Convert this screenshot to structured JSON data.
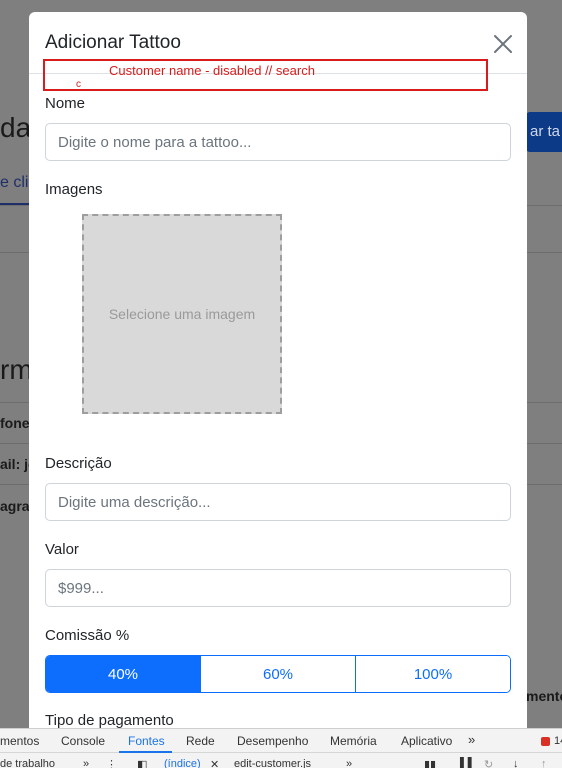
{
  "background": {
    "title_fragment": "da",
    "tab_fragment": "e cli",
    "form_title_fragment": "rm",
    "row1_fragment": "fone",
    "row2_fragment": "ail: jo",
    "row3_fragment": "agra",
    "button_fragment": "ar ta",
    "bottom_right_fragment": "mento"
  },
  "modal": {
    "title": "Adicionar Tattoo",
    "annotation": "Customer name - disabled // search",
    "annotation_mark": "c",
    "fields": {
      "name_label": "Nome",
      "name_placeholder": "Digite o nome para a tattoo...",
      "images_label": "Imagens",
      "image_placeholder": "Selecione uma imagem",
      "description_label": "Descrição",
      "description_placeholder": "Digite uma descrição...",
      "value_label": "Valor",
      "value_placeholder": "$999...",
      "commission_label": "Comissão %",
      "commission_options": [
        "40%",
        "60%",
        "100%"
      ],
      "commission_selected": "40%",
      "payment_label": "Tipo de pagamento"
    }
  },
  "devtools": {
    "tabs": [
      "mentos",
      "Console",
      "Fontes",
      "Rede",
      "Desempenho",
      "Memória",
      "Aplicativo"
    ],
    "active_tab": "Fontes",
    "more": "»",
    "error_count": "14",
    "row2": {
      "workspace": "de trabalho",
      "index_file": "(índice)",
      "other_file": "edit-customer.js"
    }
  },
  "colors": {
    "primary": "#0d6efd",
    "annotation": "#d81b1b",
    "backdrop": "#7f7f7f"
  }
}
